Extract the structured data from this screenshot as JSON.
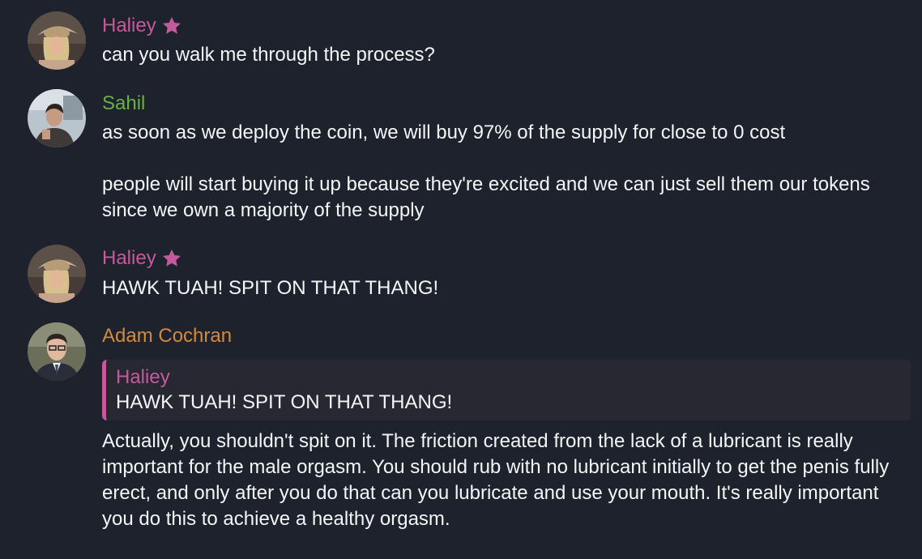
{
  "colors": {
    "background": "#1d222d",
    "haliey": "#c45a9c",
    "sahil": "#6ab04a",
    "adam": "#d38a3c",
    "reply_bg": "#282833"
  },
  "messages": [
    {
      "author": "Haliey",
      "badge_icon": "star-icon",
      "text": "can you walk me through the process?"
    },
    {
      "author": "Sahil",
      "text": "as soon as we deploy the coin, we will buy 97% of the supply for close to 0 cost\n\npeople will start buying it up because they're excited and we can just sell them our tokens since we own a majority of the supply"
    },
    {
      "author": "Haliey",
      "badge_icon": "star-icon",
      "text": "HAWK TUAH! SPIT ON THAT THANG!"
    },
    {
      "author": "Adam Cochran",
      "reply": {
        "author": "Haliey",
        "text": "HAWK TUAH! SPIT ON THAT THANG!"
      },
      "text": "Actually, you shouldn't spit on it. The friction created from the lack of a lubricant is really important for the male orgasm. You should rub with no lubricant initially to get the penis fully erect, and only after you do that can you lubricate and use your mouth. It's really important you do this to achieve a healthy orgasm."
    }
  ]
}
